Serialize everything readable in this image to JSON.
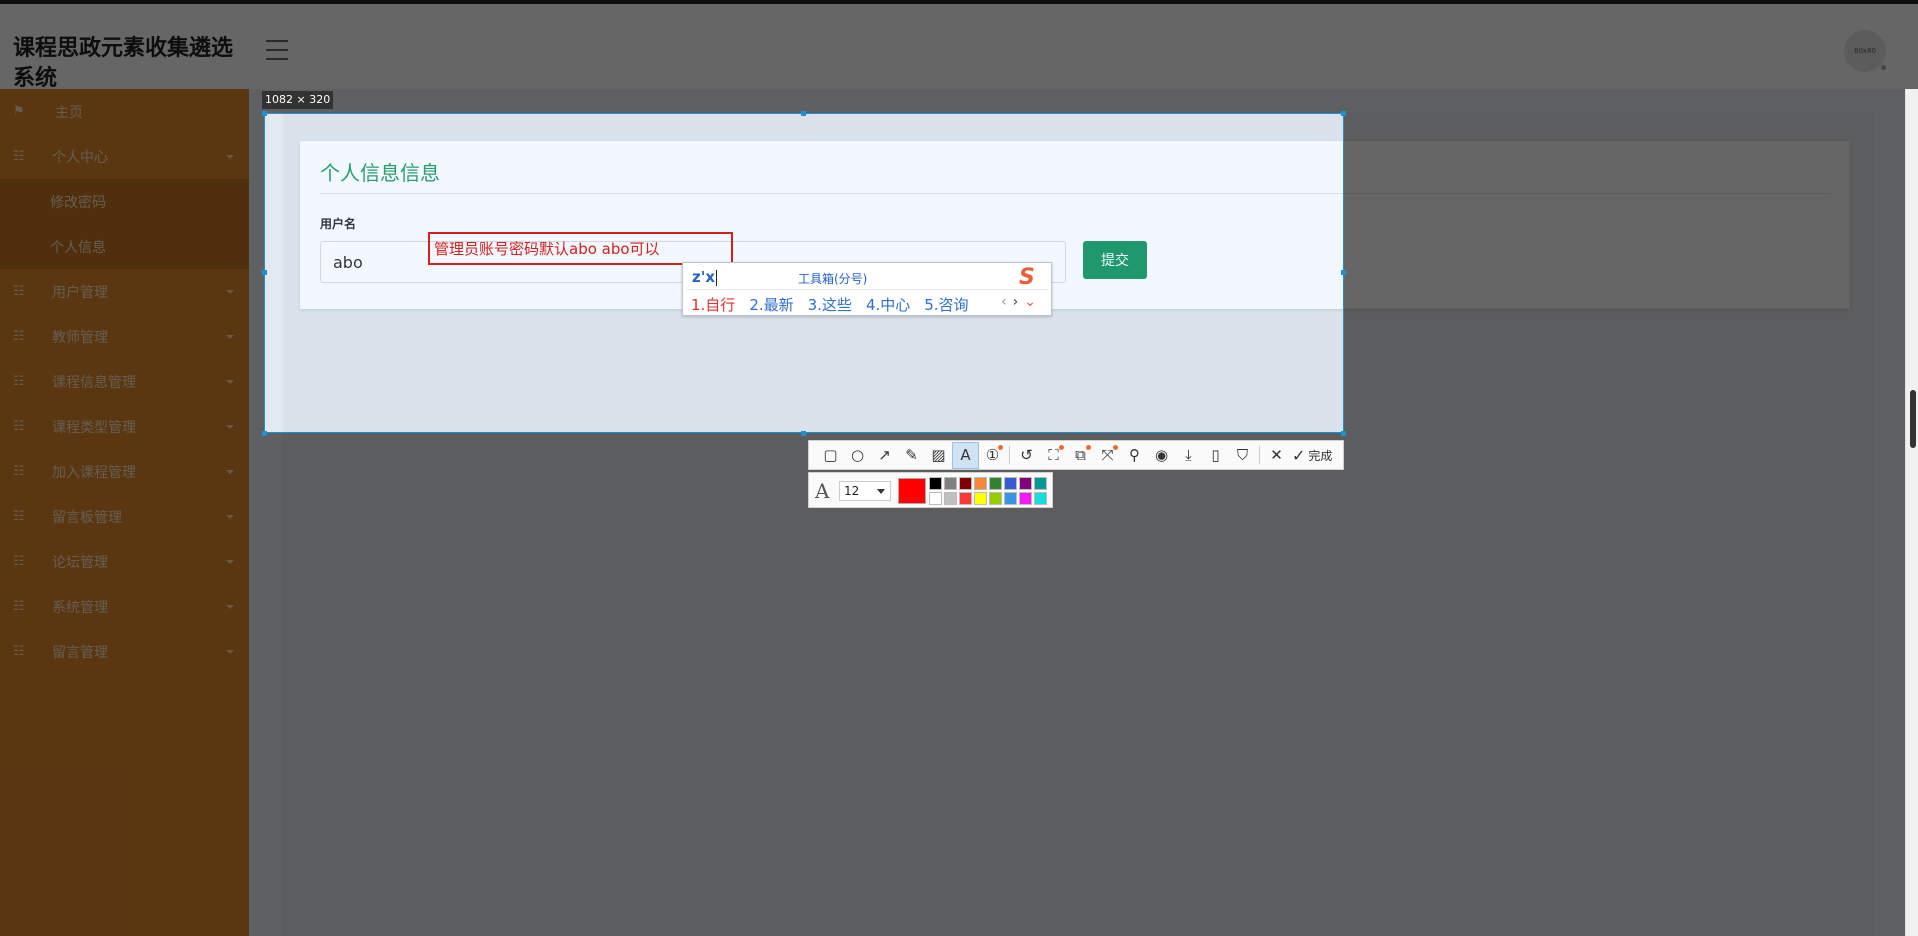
{
  "app": {
    "title": "课程思政元素收集遴选系统"
  },
  "header": {
    "avatar_text": "80x80"
  },
  "sidebar": {
    "items": [
      {
        "label": "主页",
        "icon": "flag-icon"
      },
      {
        "label": "个人中心",
        "icon": "grid-icon"
      },
      {
        "label": "修改密码",
        "icon": ""
      },
      {
        "label": "个人信息",
        "icon": ""
      },
      {
        "label": "用户管理",
        "icon": "grid-icon"
      },
      {
        "label": "教师管理",
        "icon": "grid-icon"
      },
      {
        "label": "课程信息管理",
        "icon": "grid-icon"
      },
      {
        "label": "课程类型管理",
        "icon": "grid-icon"
      },
      {
        "label": "加入课程管理",
        "icon": "grid-icon"
      },
      {
        "label": "留言板管理",
        "icon": "grid-icon"
      },
      {
        "label": "论坛管理",
        "icon": "grid-icon"
      },
      {
        "label": "系统管理",
        "icon": "grid-icon"
      },
      {
        "label": "留言管理",
        "icon": "grid-icon"
      }
    ]
  },
  "form": {
    "title": "个人信息信息",
    "username_label": "用户名",
    "username_value": "abo",
    "submit_label": "提交"
  },
  "capture": {
    "size_label": "1082 × 320",
    "annotation_text": "管理员账号密码默认abo  abo可以",
    "font_size": "12",
    "current_color": "#ff0000",
    "done_label": "完成",
    "palette": [
      "#000000",
      "#808080",
      "#800000",
      "#f7883a",
      "#308430",
      "#385ad3",
      "#800080",
      "#009999",
      "#ffffff",
      "#c0c0c0",
      "#fb3838",
      "#ffff00",
      "#99cc00",
      "#3894e4",
      "#f31bf3",
      "#16dcdc"
    ]
  },
  "ime": {
    "composition": "z'x",
    "toolbox_label": "工具箱(分号)",
    "candidates": [
      "1.自行",
      "2.最新",
      "3.这些",
      "4.中心",
      "5.咨询"
    ]
  }
}
